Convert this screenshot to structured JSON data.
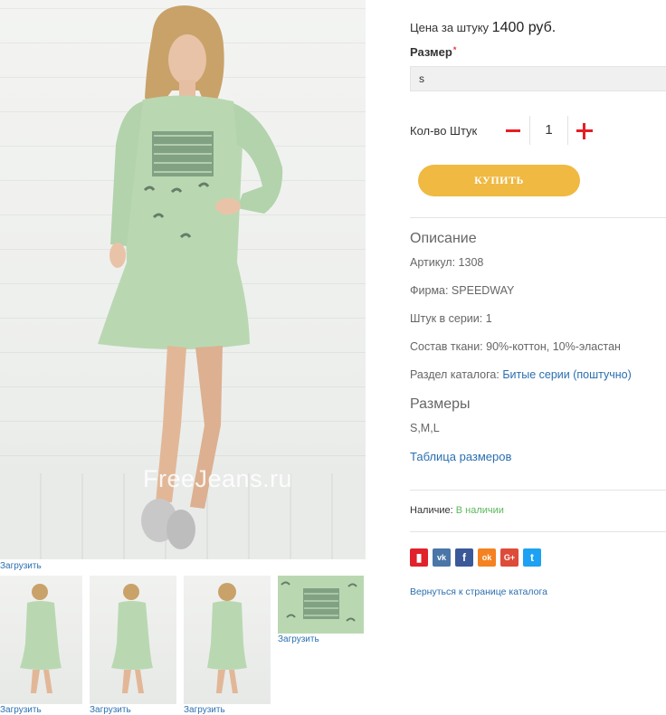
{
  "gallery": {
    "watermark": "FreeJeans.ru",
    "download_label": "Загрузить",
    "thumbnails": [
      {
        "view": "front"
      },
      {
        "view": "front"
      },
      {
        "view": "back"
      },
      {
        "view": "detail"
      }
    ]
  },
  "product": {
    "price_label": "Цена за штуку",
    "price_value": "1400 руб.",
    "size_label": "Размер",
    "required_mark": "*",
    "size_selected": "s",
    "qty_label": "Кол-во Штук",
    "qty_value": "1",
    "buy_label": "КУПИТЬ"
  },
  "description": {
    "title": "Описание",
    "article": "Артикул: 1308",
    "brand": "Фирма: SPEEDWAY",
    "pieces": "Штук в серии: 1",
    "fabric": "Состав ткани: 90%-коттон, 10%-эластан",
    "catalog_label": "Раздел каталога:",
    "catalog_link": "Битые серии (поштучно)"
  },
  "sizes": {
    "title": "Размеры",
    "values": "S,M,L",
    "table_link": "Таблица размеров"
  },
  "availability": {
    "label": "Наличие:",
    "value": "В наличии"
  },
  "share": [
    {
      "name": "bookmark-icon",
      "glyph": "▮",
      "color": "#e1212b"
    },
    {
      "name": "vk-icon",
      "glyph": "vk",
      "color": "#4a76a8"
    },
    {
      "name": "facebook-icon",
      "glyph": "f",
      "color": "#3b5998"
    },
    {
      "name": "odnoklassniki-icon",
      "glyph": "ok",
      "color": "#f58220"
    },
    {
      "name": "google-plus-icon",
      "glyph": "G+",
      "color": "#dd4b39"
    },
    {
      "name": "twitter-icon",
      "glyph": "t",
      "color": "#1da1f2"
    }
  ],
  "back_link": "Вернуться к странице каталога",
  "colors": {
    "accent": "#efb942",
    "minus_plus": "#e61e25",
    "link": "#2a6fb0",
    "in_stock": "#5cb85c",
    "dress": "#b9d8b2"
  }
}
